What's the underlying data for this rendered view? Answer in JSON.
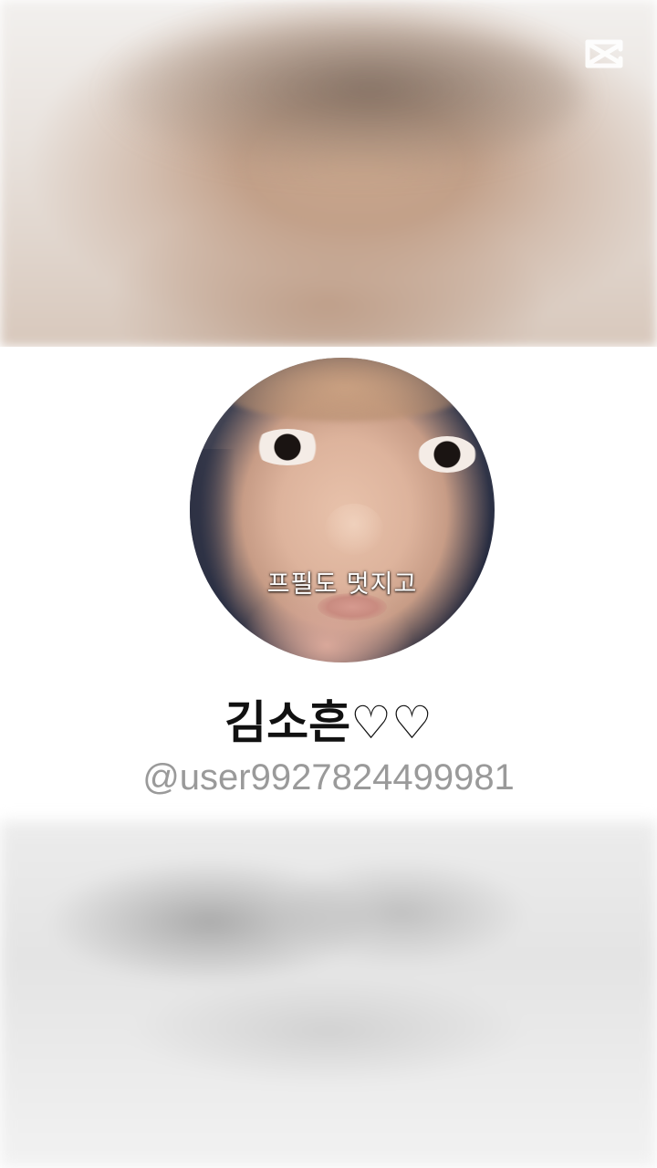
{
  "profile": {
    "caption": "프필도 멋지고",
    "display_name": "김소흔♡♡",
    "username": "@user9927824499981"
  },
  "watermark": {
    "icon": "capcut-logo-icon",
    "color": "#ffffff"
  },
  "colors": {
    "name": "#111111",
    "username": "#9a9a9a",
    "caption": "#ffffff"
  }
}
